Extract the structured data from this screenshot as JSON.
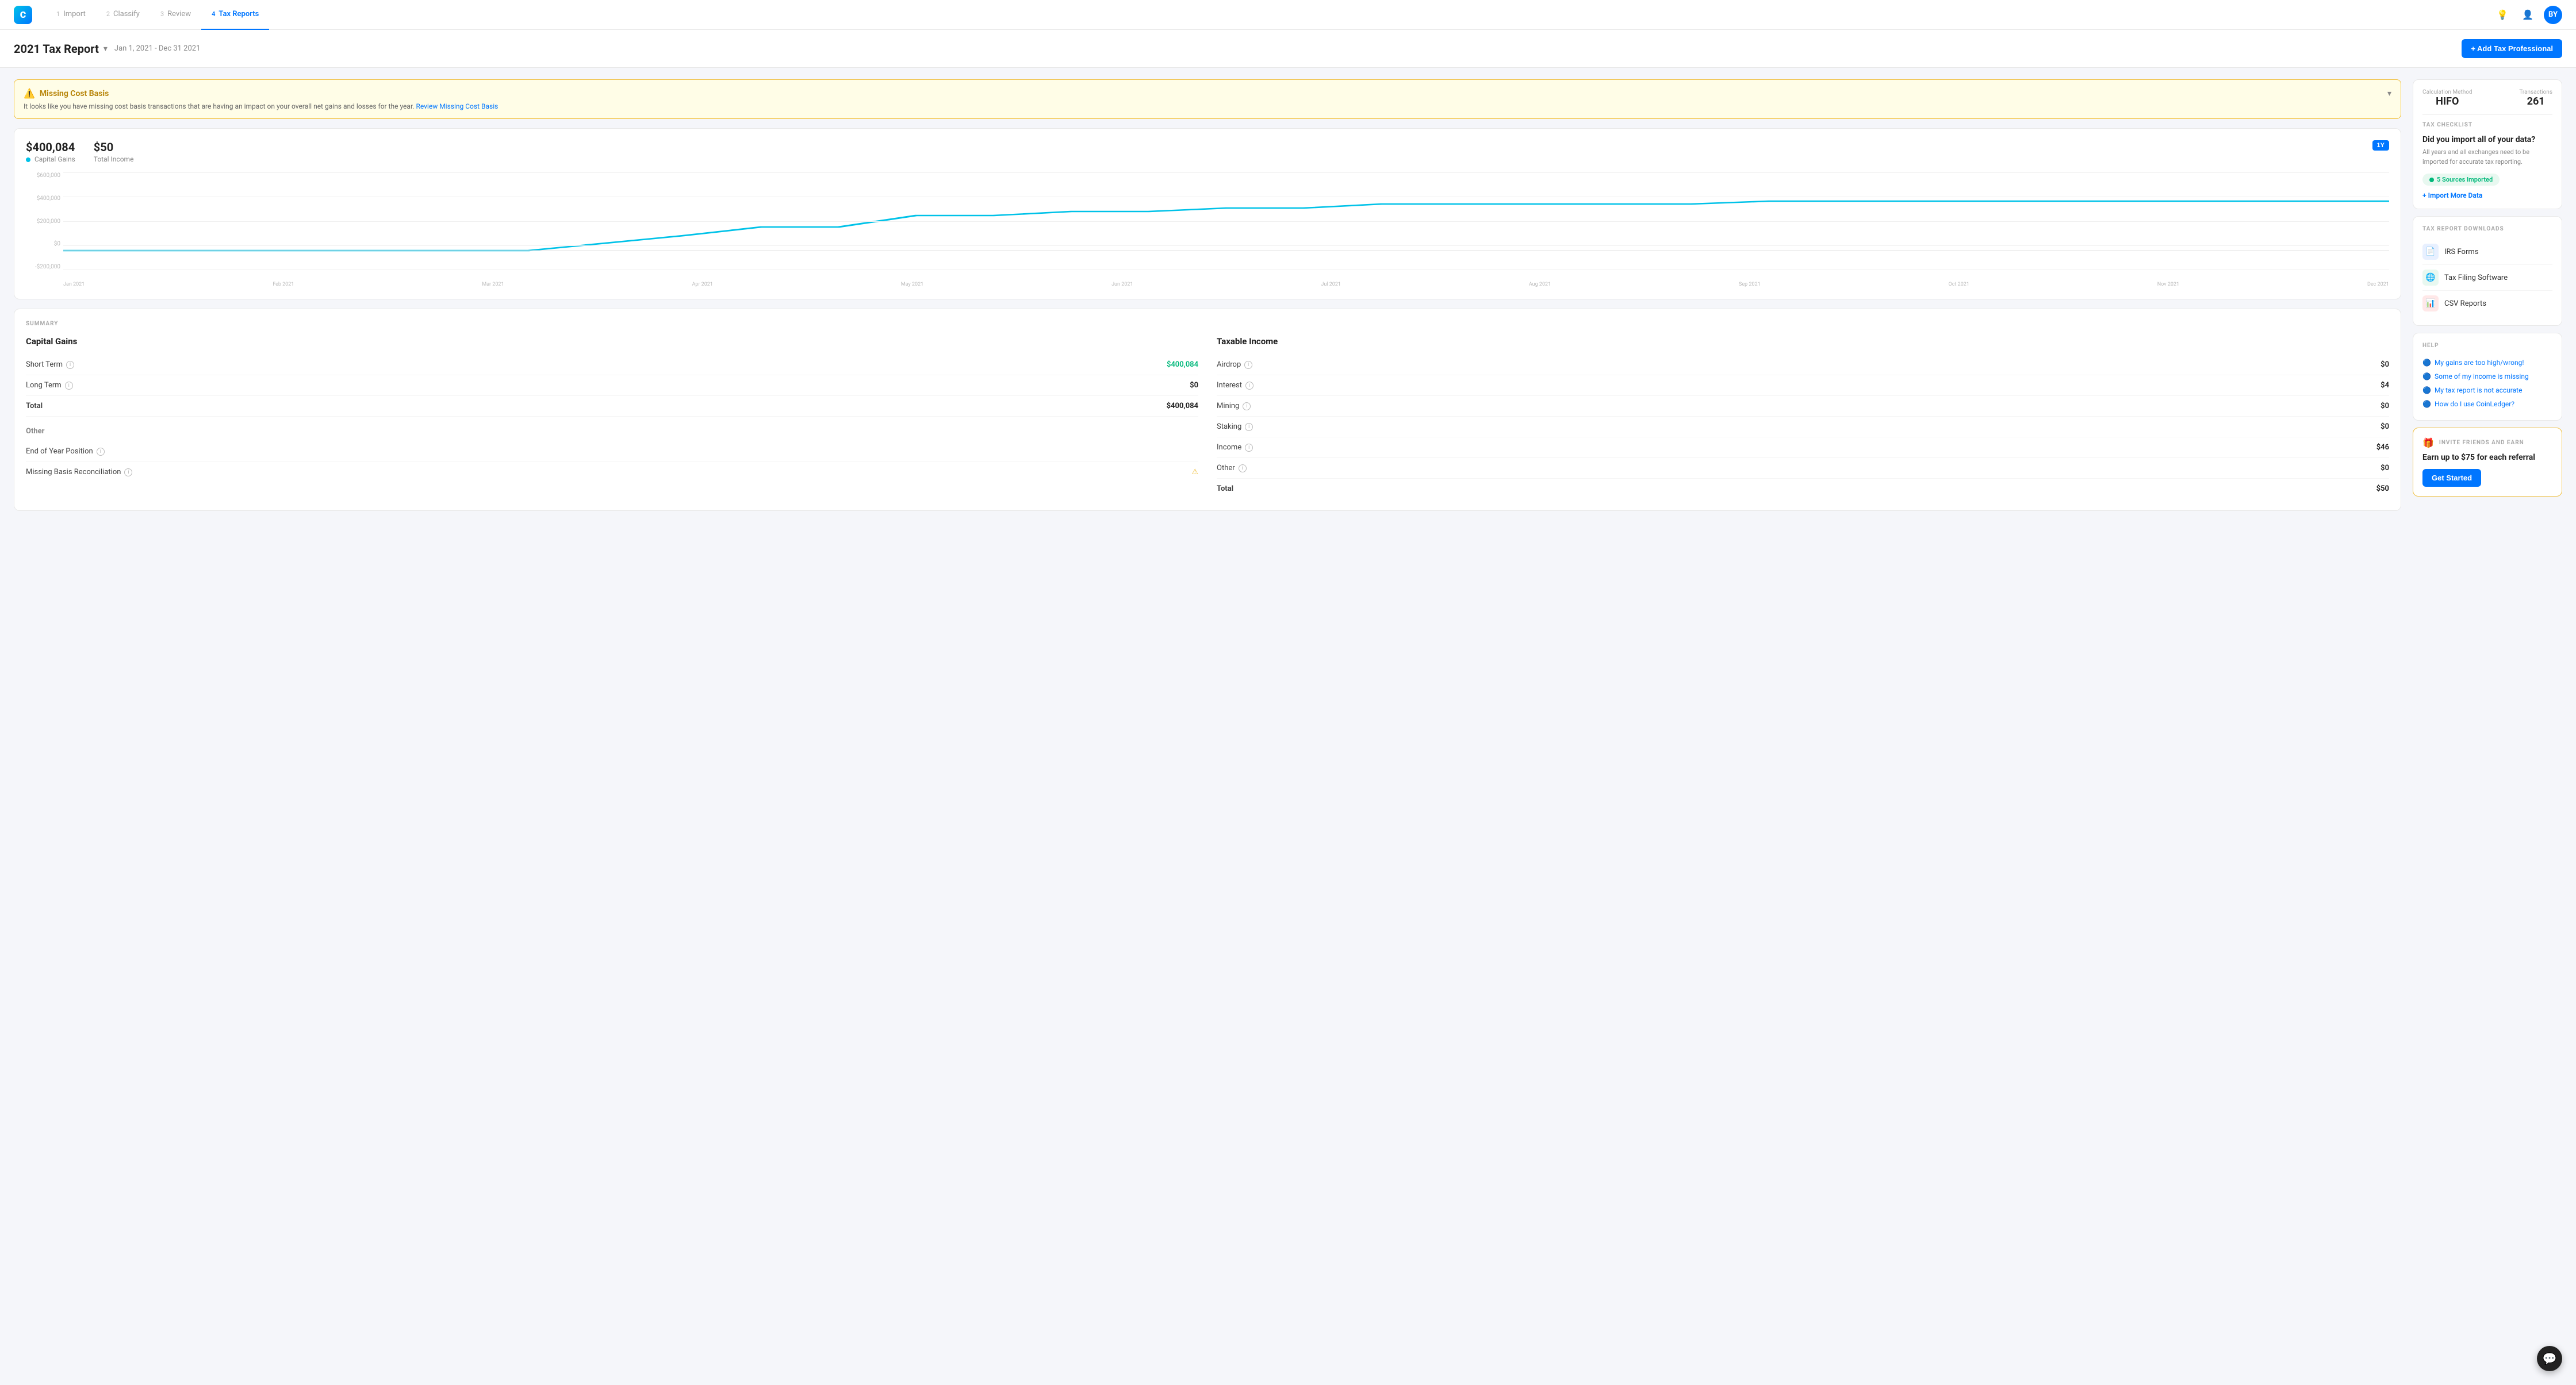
{
  "nav": {
    "logo": "C",
    "steps": [
      {
        "num": "1",
        "label": "Import",
        "active": false
      },
      {
        "num": "2",
        "label": "Classify",
        "active": false
      },
      {
        "num": "3",
        "label": "Review",
        "active": false
      },
      {
        "num": "4",
        "label": "Tax Reports",
        "active": true
      }
    ],
    "icons": [
      "lightbulb",
      "person-add"
    ],
    "avatar": "BY"
  },
  "header": {
    "title": "2021 Tax Report",
    "date_range": "Jan 1, 2021 - Dec 31 2021",
    "add_tax_btn": "+ Add Tax Professional"
  },
  "alert": {
    "icon": "⚠",
    "title": "Missing Cost Basis",
    "body": "It looks like you have missing cost basis transactions that are having an impact on your overall net gains and losses for the year.",
    "link_text": "Review Missing Cost Basis"
  },
  "chart": {
    "capital_gains_value": "$400,084",
    "capital_gains_label": "Capital Gains",
    "total_income_value": "$50",
    "total_income_label": "Total Income",
    "period_btn": "1Y",
    "y_labels": [
      "$600,000",
      "$400,000",
      "$200,000",
      "$0",
      "-$200,000"
    ],
    "x_labels": [
      "Jan 2021",
      "Feb 2021",
      "Mar 2021",
      "Apr 2021",
      "May 2021",
      "Jun 2021",
      "Jul 2021",
      "Aug 2021",
      "Sep 2021",
      "Oct 2021",
      "Nov 2021",
      "Dec 2021"
    ]
  },
  "summary": {
    "section_label": "SUMMARY",
    "capital_gains": {
      "title": "Capital Gains",
      "rows": [
        {
          "label": "Short Term",
          "value": "$400,084",
          "type": "positive",
          "has_info": true
        },
        {
          "label": "Long Term",
          "value": "$0",
          "type": "normal",
          "has_info": true
        },
        {
          "label": "Total",
          "value": "$400,084",
          "type": "total",
          "has_info": false
        }
      ],
      "other_title": "Other",
      "other_rows": [
        {
          "label": "End of Year Position",
          "value": "",
          "type": "normal",
          "has_info": true,
          "has_warn": false
        },
        {
          "label": "Missing Basis Reconciliation",
          "value": "",
          "type": "normal",
          "has_info": true,
          "has_warn": true
        }
      ]
    },
    "taxable_income": {
      "title": "Taxable Income",
      "rows": [
        {
          "label": "Airdrop",
          "value": "$0",
          "has_info": true
        },
        {
          "label": "Interest",
          "value": "$4",
          "has_info": true
        },
        {
          "label": "Mining",
          "value": "$0",
          "has_info": true
        },
        {
          "label": "Staking",
          "value": "$0",
          "has_info": true
        },
        {
          "label": "Income",
          "value": "$46",
          "has_info": true
        },
        {
          "label": "Other",
          "value": "$0",
          "has_info": true
        },
        {
          "label": "Total",
          "value": "$50",
          "has_info": false
        }
      ]
    }
  },
  "sidebar": {
    "calculation": {
      "method_label": "Calculation Method",
      "method_value": "HIFO",
      "transactions_label": "Transactions",
      "transactions_value": "261"
    },
    "checklist": {
      "section_label": "TAX CHECKLIST",
      "title": "Did you import all of your data?",
      "desc": "All years and all exchanges need to be imported for accurate tax reporting.",
      "badge_text": "5 Sources Imported",
      "import_link": "+ Import More Data"
    },
    "downloads": {
      "section_label": "TAX REPORT DOWNLOADS",
      "items": [
        {
          "icon": "📄",
          "icon_class": "dl-icon-blue",
          "label": "IRS Forms"
        },
        {
          "icon": "🌐",
          "icon_class": "dl-icon-green",
          "label": "Tax Filing Software"
        },
        {
          "icon": "📊",
          "icon_class": "dl-icon-red",
          "label": "CSV Reports"
        }
      ]
    },
    "help": {
      "section_label": "HELP",
      "links": [
        "My gains are too high/wrong!",
        "Some of my income is missing",
        "My tax report is not accurate",
        "How do I use CoinLedger?"
      ]
    },
    "referral": {
      "section_label": "INVITE FRIENDS AND EARN",
      "icon": "🎁",
      "title": "Earn up to $75 for each referral",
      "btn": "Get Started"
    }
  },
  "chat": {
    "icon": "💬"
  }
}
